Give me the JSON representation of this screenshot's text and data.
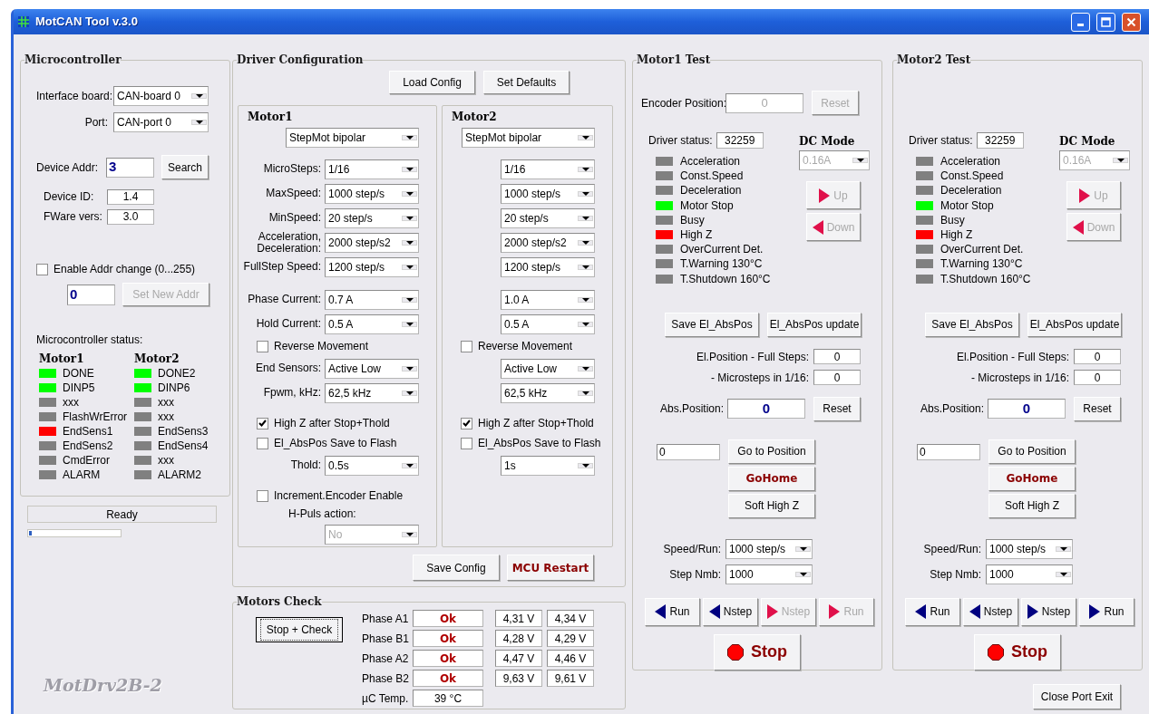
{
  "window": {
    "title": "MotCAN Tool v.3.0"
  },
  "microcontroller": {
    "title": "Microcontroller",
    "interface_board": {
      "label": "Interface board:",
      "value": "CAN-board 0"
    },
    "port": {
      "label": "Port:",
      "value": "CAN-port 0"
    },
    "device_addr": {
      "label": "Device Addr:",
      "value": "3"
    },
    "search_button": "Search",
    "device_id": {
      "label": "Device ID:",
      "value": "1.4"
    },
    "fware_vers": {
      "label": "FWare vers:",
      "value": "3.0"
    },
    "enable_addr_change": {
      "label": "Enable Addr change (0...255)",
      "checked": false
    },
    "new_addr": "0",
    "set_new_addr_button": {
      "label": "Set New Addr",
      "disabled": true
    },
    "status_title": "Microcontroller status:",
    "status_columns": [
      {
        "title": "Motor1",
        "flags": [
          {
            "label": "DONE",
            "color": "#00ff00"
          },
          {
            "label": "DINP5",
            "color": "#00ff00"
          },
          {
            "label": "xxx",
            "color": "#808080"
          },
          {
            "label": "FlashWrError",
            "color": "#808080"
          },
          {
            "label": "EndSens1",
            "color": "#ff0000"
          },
          {
            "label": "EndSens2",
            "color": "#808080"
          },
          {
            "label": "CmdError",
            "color": "#808080"
          },
          {
            "label": "ALARM",
            "color": "#808080"
          }
        ]
      },
      {
        "title": "Motor2",
        "flags": [
          {
            "label": "DONE2",
            "color": "#00ff00"
          },
          {
            "label": "DINP6",
            "color": "#00ff00"
          },
          {
            "label": "xxx",
            "color": "#808080"
          },
          {
            "label": "xxx",
            "color": "#808080"
          },
          {
            "label": "EndSens3",
            "color": "#808080"
          },
          {
            "label": "EndSens4",
            "color": "#808080"
          },
          {
            "label": "xxx",
            "color": "#808080"
          },
          {
            "label": "ALARM2",
            "color": "#808080"
          }
        ]
      }
    ]
  },
  "status_bar": {
    "text": "Ready",
    "level": 0.03
  },
  "logo": "MotDrv2B-2",
  "driver_configuration": {
    "title": "Driver Configuration",
    "buttons": [
      "Load Config",
      "Set Defaults"
    ],
    "motors": [
      {
        "title": "Motor1",
        "sections": [
          [
            {
              "kind": "select",
              "value": "StepMot bipolar"
            }
          ],
          [
            {
              "kind": "select",
              "label": "MicroSteps:",
              "value": "1/16"
            },
            {
              "kind": "select",
              "label": "MaxSpeed:",
              "value": "1000 step/s"
            },
            {
              "kind": "select",
              "label": "MinSpeed:",
              "value": "20 step/s"
            },
            {
              "kind": "select",
              "label": "Acceleration, Deceleration:",
              "value": "2000 step/s2"
            },
            {
              "kind": "select",
              "label": "FullStep Speed:",
              "value": "1200 step/s"
            }
          ],
          [
            {
              "kind": "select",
              "label": "Phase Current:",
              "value": "0.7 A"
            },
            {
              "kind": "select",
              "label": "Hold Current:",
              "value": "0.5 A"
            },
            {
              "kind": "checkbox",
              "label": "Reverse Movement",
              "checked": false
            },
            {
              "kind": "select",
              "label": "End Sensors:",
              "value": "Active Low"
            },
            {
              "kind": "select",
              "label": "Fpwm, kHz:",
              "value": "62,5 kHz"
            }
          ],
          [
            {
              "kind": "checkbox",
              "label": "High Z after Stop+Thold",
              "checked": true
            },
            {
              "kind": "checkbox",
              "label": "El_AbsPos Save to Flash",
              "checked": false
            },
            {
              "kind": "select",
              "label": "Thold:",
              "value": "0.5s"
            }
          ],
          [
            {
              "kind": "checkbox",
              "label": "Increment.Encoder Enable",
              "checked": false
            },
            {
              "kind": "caption",
              "label": "H-Puls action:"
            },
            {
              "kind": "select",
              "value": "No",
              "disabled": true
            }
          ]
        ]
      },
      {
        "title": "Motor2",
        "sections": [
          [
            {
              "kind": "select",
              "value": "StepMot bipolar"
            }
          ],
          [
            {
              "kind": "select",
              "value": "1/16"
            },
            {
              "kind": "select",
              "value": "1000 step/s"
            },
            {
              "kind": "select",
              "value": "20 step/s"
            },
            {
              "kind": "select",
              "value": "2000 step/s2"
            },
            {
              "kind": "select",
              "value": "1200 step/s"
            }
          ],
          [
            {
              "kind": "select",
              "value": "1.0 A"
            },
            {
              "kind": "select",
              "value": "0.5 A"
            },
            {
              "kind": "checkbox",
              "label": "Reverse Movement",
              "checked": false
            },
            {
              "kind": "select",
              "value": "Active Low"
            },
            {
              "kind": "select",
              "value": "62,5 kHz"
            }
          ],
          [
            {
              "kind": "checkbox",
              "label": "High Z after Stop+Thold",
              "checked": true
            },
            {
              "kind": "checkbox",
              "label": "El_AbsPos Save to Flash",
              "checked": false
            },
            {
              "kind": "select",
              "value": "1s"
            }
          ]
        ]
      }
    ],
    "footer_buttons": [
      {
        "label": "Save Config",
        "kind": "normal"
      },
      {
        "label": "MCU Restart",
        "kind": "emphasis"
      }
    ]
  },
  "motors_check": {
    "title": "Motors Check",
    "button": "Stop + Check",
    "phases": [
      {
        "label": "Phase A1",
        "status": "Ok",
        "voltage_1": "4,31 V",
        "voltage_2": "4,34 V"
      },
      {
        "label": "Phase B1",
        "status": "Ok",
        "voltage_1": "4,28 V",
        "voltage_2": "4,29 V"
      },
      {
        "label": "Phase A2",
        "status": "Ok",
        "voltage_1": "4,47 V",
        "voltage_2": "4,46 V"
      },
      {
        "label": "Phase B2",
        "status": "Ok",
        "voltage_1": "9,63 V",
        "voltage_2": "9,61 V"
      }
    ],
    "temperature": {
      "label": "µC Temp.",
      "value": "39 °C"
    }
  },
  "motor_tests": [
    {
      "title": "Motor1 Test",
      "encoder": {
        "label": "Encoder Position:",
        "value": "0",
        "button": "Reset",
        "disabled": true
      },
      "driver_status": {
        "label": "Driver status:",
        "value": "32259"
      },
      "dc_mode": {
        "title": "DC Mode",
        "value": "0.16A",
        "disabled": true
      },
      "jog_buttons": [
        {
          "label": "Up",
          "kind": "right",
          "disabled": true
        },
        {
          "label": "Down",
          "kind": "left",
          "disabled": true
        }
      ],
      "flags": [
        {
          "label": "Acceleration",
          "color": "#808080"
        },
        {
          "label": "Const.Speed",
          "color": "#808080"
        },
        {
          "label": "Deceleration",
          "color": "#808080"
        },
        {
          "label": "Motor Stop",
          "color": "#00ff00"
        },
        {
          "label": "Busy",
          "color": "#808080"
        },
        {
          "label": "High Z",
          "color": "#ff0000"
        },
        {
          "label": "OverCurrent Det.",
          "color": "#808080"
        },
        {
          "label": "T.Warning 130°C",
          "color": "#808080"
        },
        {
          "label": "T.Shutdown 160°C",
          "color": "#808080"
        }
      ],
      "abs_buttons": [
        "Save El_AbsPos",
        "El_AbsPos update"
      ],
      "el_position": [
        {
          "label": "El.Position - Full Steps:",
          "value": "0"
        },
        {
          "label": "- Microsteps in 1/16:",
          "value": "0"
        }
      ],
      "abs_position": {
        "label": "Abs.Position:",
        "value": "0",
        "button": "Reset"
      },
      "target": "0",
      "position_buttons": [
        {
          "label": "Go to Position",
          "kind": "normal"
        },
        {
          "label": "GoHome",
          "kind": "emphasis"
        },
        {
          "label": "Soft High Z",
          "kind": "normal"
        }
      ],
      "speed_run": {
        "label": "Speed/Run:",
        "value": "1000 step/s"
      },
      "step_nmb": {
        "label": "Step Nmb:",
        "value": "1000"
      },
      "run_buttons": [
        {
          "label": "Run",
          "kind": "left",
          "disabled": false
        },
        {
          "label": "Nstep",
          "kind": "left",
          "disabled": false
        },
        {
          "label": "Nstep",
          "kind": "right",
          "disabled": true
        },
        {
          "label": "Run",
          "kind": "right",
          "disabled": true
        }
      ],
      "stop_button": "Stop"
    },
    {
      "title": "Motor2 Test",
      "driver_status": {
        "label": "Driver status:",
        "value": "32259"
      },
      "dc_mode": {
        "title": "DC Mode",
        "value": "0.16A",
        "disabled": true
      },
      "jog_buttons": [
        {
          "label": "Up",
          "kind": "right",
          "disabled": true
        },
        {
          "label": "Down",
          "kind": "left",
          "disabled": true
        }
      ],
      "flags": [
        {
          "label": "Acceleration",
          "color": "#808080"
        },
        {
          "label": "Const.Speed",
          "color": "#808080"
        },
        {
          "label": "Deceleration",
          "color": "#808080"
        },
        {
          "label": "Motor Stop",
          "color": "#00ff00"
        },
        {
          "label": "Busy",
          "color": "#808080"
        },
        {
          "label": "High Z",
          "color": "#ff0000"
        },
        {
          "label": "OverCurrent Det.",
          "color": "#808080"
        },
        {
          "label": "T.Warning 130°C",
          "color": "#808080"
        },
        {
          "label": "T.Shutdown 160°C",
          "color": "#808080"
        }
      ],
      "abs_buttons": [
        "Save El_AbsPos",
        "El_AbsPos update"
      ],
      "el_position": [
        {
          "label": "El.Position - Full Steps:",
          "value": "0"
        },
        {
          "label": "- Microsteps in 1/16:",
          "value": "0"
        }
      ],
      "abs_position": {
        "label": "Abs.Position:",
        "value": "0",
        "button": "Reset"
      },
      "target": "0",
      "position_buttons": [
        {
          "label": "Go to Position",
          "kind": "normal"
        },
        {
          "label": "GoHome",
          "kind": "emphasis"
        },
        {
          "label": "Soft High Z",
          "kind": "normal"
        }
      ],
      "speed_run": {
        "label": "Speed/Run:",
        "value": "1000 step/s"
      },
      "step_nmb": {
        "label": "Step Nmb:",
        "value": "1000"
      },
      "run_buttons": [
        {
          "label": "Run",
          "kind": "left",
          "disabled": false
        },
        {
          "label": "Nstep",
          "kind": "left",
          "disabled": false
        },
        {
          "label": "Nstep",
          "kind": "right",
          "disabled": false
        },
        {
          "label": "Run",
          "kind": "right",
          "disabled": false
        }
      ],
      "stop_button": "Stop"
    }
  ],
  "close_button": "Close Port Exit"
}
